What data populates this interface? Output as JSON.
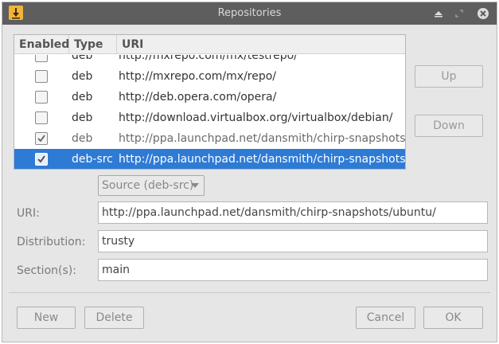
{
  "window": {
    "title": "Repositories"
  },
  "list": {
    "headers": {
      "enabled": "Enabled",
      "type": "Type",
      "uri": "URI"
    },
    "rows": [
      {
        "checked": false,
        "type": "deb",
        "uri": "http://mxrepo.com/mx/testrepo/"
      },
      {
        "checked": false,
        "type": "deb",
        "uri": "http://mxrepo.com/mx/repo/"
      },
      {
        "checked": false,
        "type": "deb",
        "uri": "http://deb.opera.com/opera/"
      },
      {
        "checked": false,
        "type": "deb",
        "uri": "http://download.virtualbox.org/virtualbox/debian/"
      },
      {
        "checked": true,
        "type": "deb",
        "uri": "http://ppa.launchpad.net/dansmith/chirp-snapshots/ubuntu/"
      },
      {
        "checked": true,
        "type": "deb-src",
        "uri": "http://ppa.launchpad.net/dansmith/chirp-snapshots/ubuntu/"
      }
    ]
  },
  "side": {
    "up_label": "Up",
    "down_label": "Down"
  },
  "form": {
    "source_combo": "Source (deb-src)",
    "uri_label": "URI:",
    "uri_value": "http://ppa.launchpad.net/dansmith/chirp-snapshots/ubuntu/",
    "distribution_label": "Distribution:",
    "distribution_value": "trusty",
    "sections_label": "Section(s):",
    "sections_value": "main"
  },
  "buttons": {
    "new_label": "New",
    "delete_label": "Delete",
    "cancel_label": "Cancel",
    "ok_label": "OK"
  },
  "colors": {
    "selection": "#2e7bd6",
    "titlebar": "#5e5e5e",
    "app_icon": "#f2b33d"
  },
  "icons": [
    "app-download-icon",
    "minimize-icon",
    "restore-icon",
    "close-icon",
    "checkmark-icon",
    "dropdown-arrow-icon"
  ]
}
